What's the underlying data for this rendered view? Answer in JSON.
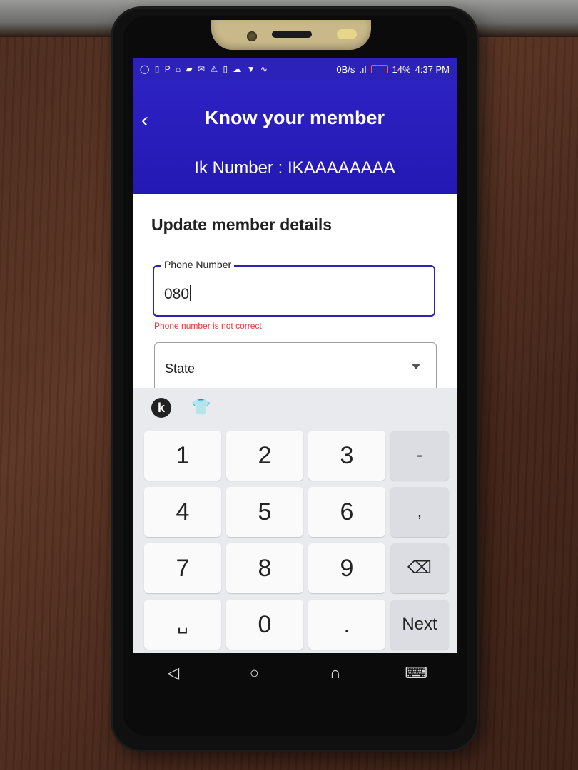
{
  "status_bar": {
    "icons": "◯ ▯ P ⌂ ▰ ✉ ⚠ ▯ ☁ ▼ ∿",
    "network_speed": "0B/s",
    "battery": "14%",
    "time": "4:37 PM"
  },
  "app_bar": {
    "title": "Know your member",
    "ik_number": "Ik Number : IKAAAAAAAA"
  },
  "form": {
    "title": "Update member details",
    "phone_label": "Phone Number",
    "phone_value": "080",
    "phone_error": "Phone number is not correct",
    "state_label": "State"
  },
  "keyboard": {
    "logo_letter": "k",
    "keys": [
      "1",
      "2",
      "3",
      "-",
      "4",
      "5",
      "6",
      ",",
      "7",
      "8",
      "9",
      "⌫",
      "␣",
      "0",
      ".",
      "Next"
    ]
  },
  "colors": {
    "app_bar": "#2d22c2",
    "focus_border": "#2d22b4",
    "error": "#e53935"
  },
  "nav": {
    "back": "◁",
    "home": "○",
    "recents": "∩",
    "keyboard": "⌨"
  }
}
